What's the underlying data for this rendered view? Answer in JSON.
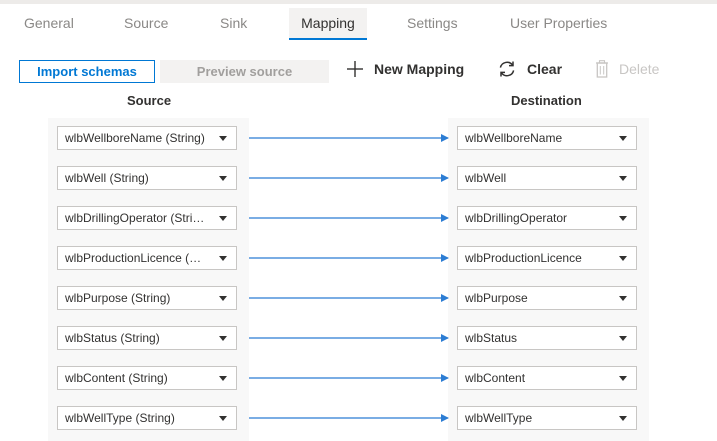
{
  "tabs": [
    "General",
    "Source",
    "Sink",
    "Mapping",
    "Settings",
    "User Properties"
  ],
  "active_tab": "Mapping",
  "toolbar": {
    "import_label": "Import schemas",
    "preview_label": "Preview source",
    "new_mapping_label": "New Mapping",
    "clear_label": "Clear",
    "delete_label": "Delete"
  },
  "headers": {
    "source": "Source",
    "destination": "Destination"
  },
  "mappings": [
    {
      "source": "wlbWellboreName (String)",
      "destination": "wlbWellboreName"
    },
    {
      "source": "wlbWell (String)",
      "destination": "wlbWell"
    },
    {
      "source": "wlbDrillingOperator (String)",
      "destination": "wlbDrillingOperator"
    },
    {
      "source": "wlbProductionLicence (String)",
      "destination": "wlbProductionLicence"
    },
    {
      "source": "wlbPurpose (String)",
      "destination": "wlbPurpose"
    },
    {
      "source": "wlbStatus (String)",
      "destination": "wlbStatus"
    },
    {
      "source": "wlbContent (String)",
      "destination": "wlbContent"
    },
    {
      "source": "wlbWellType (String)",
      "destination": "wlbWellType"
    }
  ],
  "colors": {
    "accent": "#0078d4",
    "arrow": "#2b7cd3"
  },
  "icons": {
    "new_mapping": "plus-icon",
    "clear": "refresh-icon",
    "delete": "trash-icon"
  }
}
